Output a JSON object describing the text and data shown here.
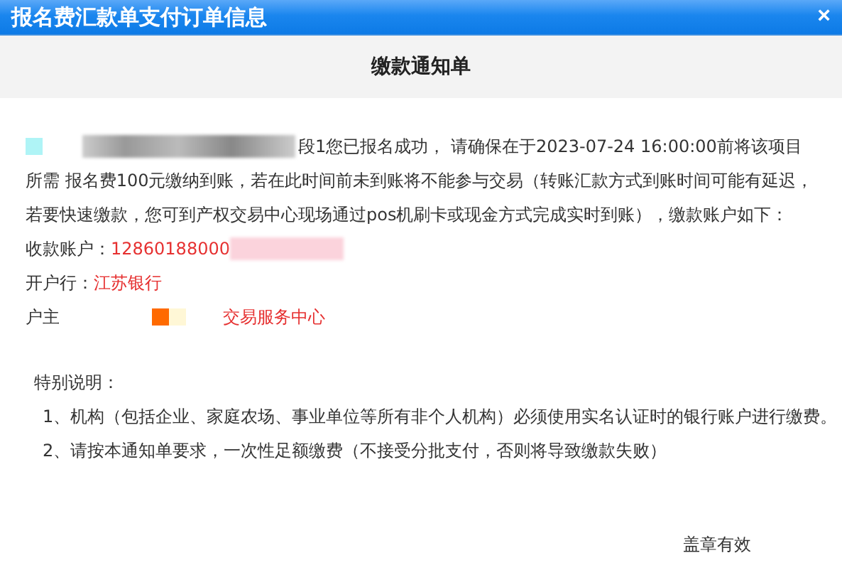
{
  "window": {
    "title": "报名费汇款单支付订单信息",
    "close": "×"
  },
  "notice": {
    "heading": "缴款通知单",
    "intro_lines": [
      "段1您已报名成功， 请确保在于2023-07-24 16:00:00前将该项目",
      "所需 报名费100元缴纳到账，若在此时间前未到账将不能参与交易（转账汇款方式到账时间可能有延迟，",
      "若要快速缴款，您可到产权交易中心现场通过pos机刷卡或现金方式完成实时到账），缴款账户如下："
    ],
    "fields": [
      {
        "label": "收款账户：",
        "value": "12860188000",
        "redacted": true
      },
      {
        "label": "开户行：",
        "value": "江苏银行"
      },
      {
        "label": "户主",
        "value": "交易服务中心",
        "redacted": true
      }
    ],
    "notes_title": "特别说明：",
    "notes": [
      "1、机构（包括企业、家庭农场、事业单位等所有非个人机构）必须使用实名认证时的银行账户进行缴费。",
      "2、请按本通知单要求，一次性足额缴费（不接受分批支付，否则将导致缴款失败）"
    ],
    "footer": "盖章有效"
  }
}
